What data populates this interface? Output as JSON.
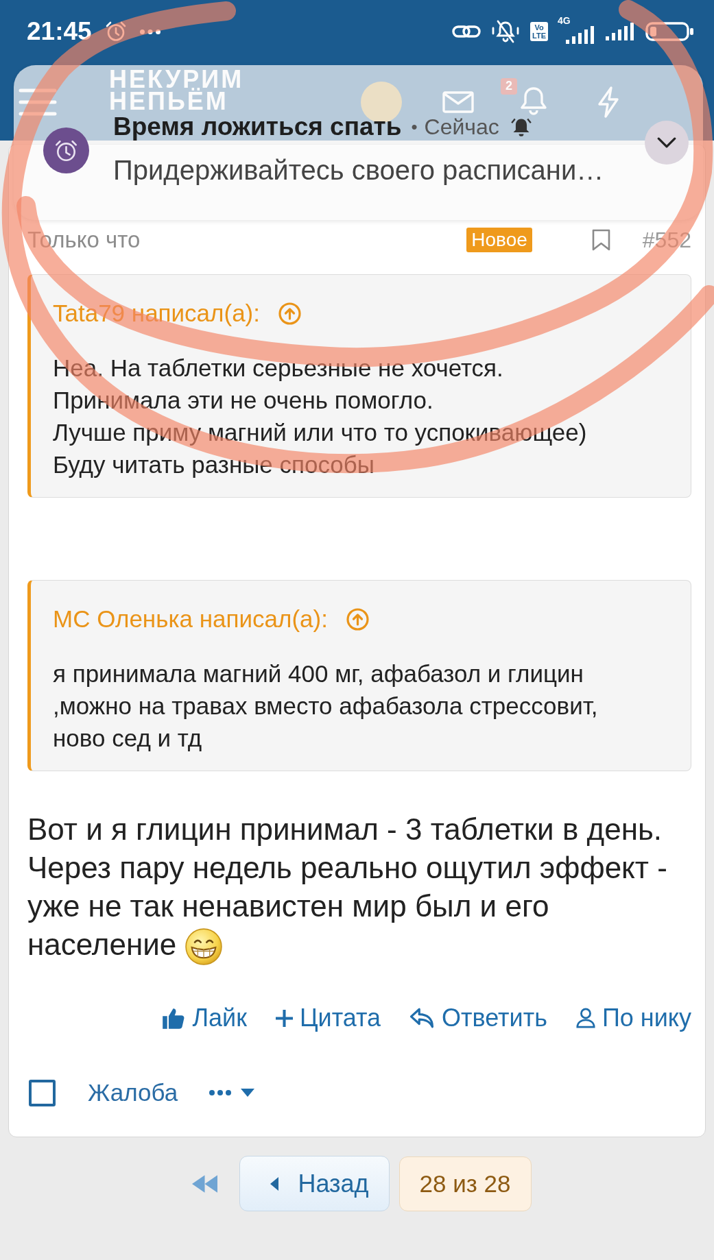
{
  "status_bar": {
    "time": "21:45",
    "volte": [
      "Vo",
      "LTE"
    ],
    "network": "4G"
  },
  "site_header": {
    "logo": [
      "НЕКУРИМ",
      "НЕПЬЁМ"
    ],
    "notification_count": "2"
  },
  "notification": {
    "title": "Время ложиться спать",
    "separator": "•",
    "time": "Сейчас",
    "message": "Придерживайтесь своего расписани…"
  },
  "post": {
    "time": "Только что",
    "badge": "Новое",
    "number": "#552",
    "quotes": [
      {
        "author": "Tata79 написал(а):",
        "text": "Неа. На таблетки серьезные не хочется.\nПринимала эти не очень помогло.\nЛучше приму магний или что то успокивающее)\nБуду читать разные способы"
      },
      {
        "author": "МС Оленька написал(а):",
        "text": "я принимала магний 400 мг, афабазол и глицин ,можно на травах вместо афабазола стрессовит, ново сед и тд"
      }
    ],
    "text": "Вот и я глицин принимал - 3 таблетки в день. Через пару недель реально ощутил эффект - уже не так ненавистен мир был и его население",
    "actions": [
      {
        "kind": "like",
        "label": "Лайк"
      },
      {
        "kind": "quote",
        "label": "Цитата"
      },
      {
        "kind": "reply",
        "label": "Ответить"
      },
      {
        "kind": "mention",
        "label": "По нику"
      }
    ],
    "select": {
      "checked": false
    },
    "report": "Жалоба"
  },
  "pagination": {
    "previous": "Назад",
    "page": "28 из 28"
  }
}
